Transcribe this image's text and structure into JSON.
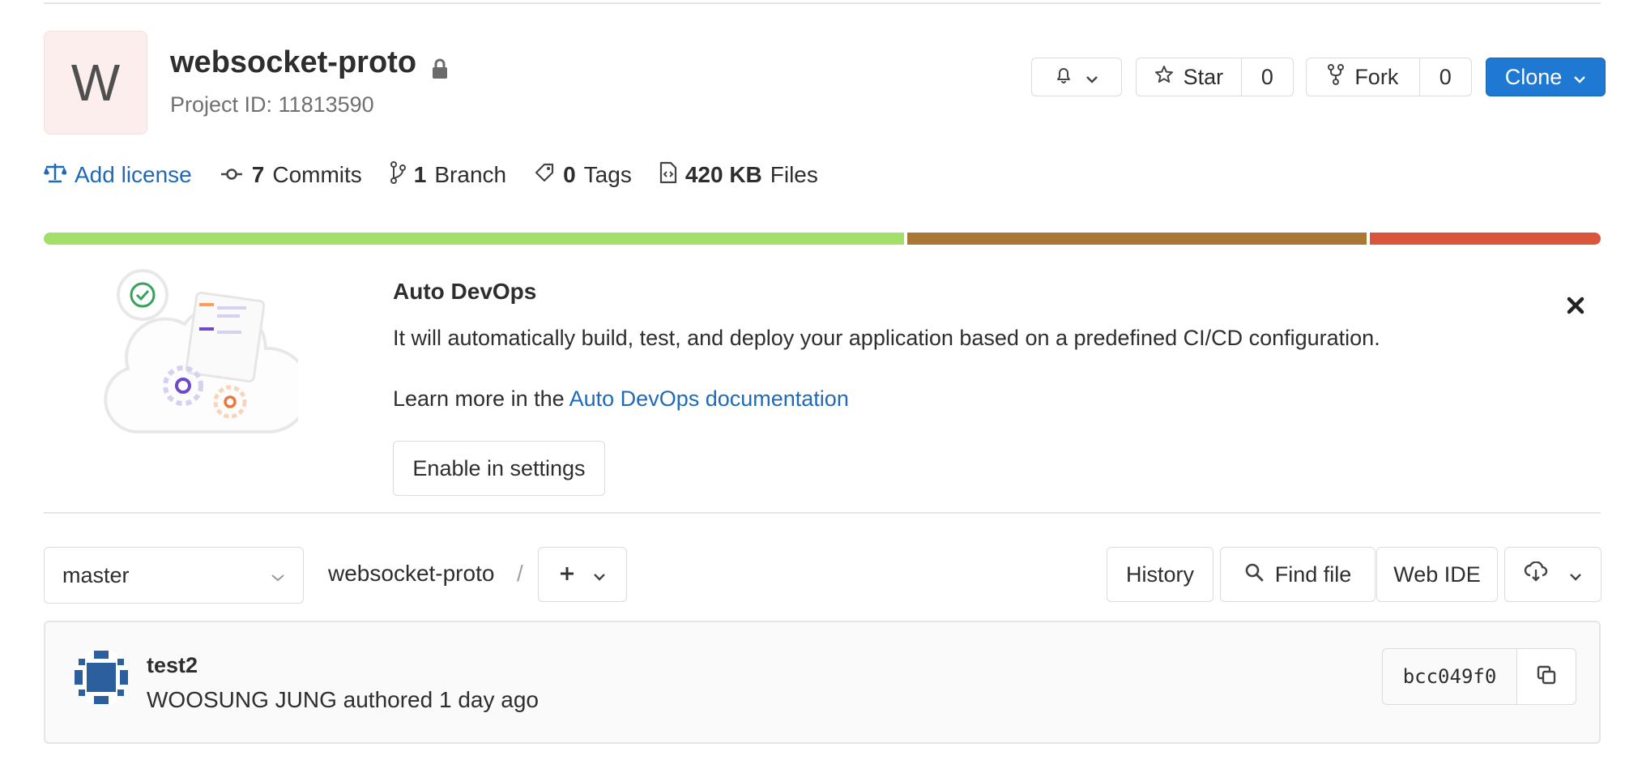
{
  "project": {
    "avatar_letter": "W",
    "name": "websocket-proto",
    "id_text": "Project ID: 11813590"
  },
  "header_actions": {
    "star_label": "Star",
    "star_count": "0",
    "fork_label": "Fork",
    "fork_count": "0",
    "clone_label": "Clone"
  },
  "stats": {
    "license_label": "Add license",
    "commits_count": "7",
    "commits_label": "Commits",
    "branches_count": "1",
    "branches_label": "Branch",
    "tags_count": "0",
    "tags_label": "Tags",
    "files_size": "420 KB",
    "files_label": "Files"
  },
  "languages": [
    {
      "color": "#a2e06a",
      "fraction": 0.555
    },
    {
      "color": "#a97834",
      "fraction": 0.296
    },
    {
      "color": "#d9553c",
      "fraction": 0.149
    }
  ],
  "auto_devops": {
    "title": "Auto DevOps",
    "description": "It will automatically build, test, and deploy your application based on a predefined CI/CD configuration.",
    "learn_prefix": "Learn more in the ",
    "learn_link": "Auto DevOps documentation",
    "enable_label": "Enable in settings"
  },
  "file_nav": {
    "branch": "master",
    "breadcrumb": "websocket-proto",
    "separator": "/",
    "history_label": "History",
    "find_file_label": "Find file",
    "web_ide_label": "Web IDE"
  },
  "last_commit": {
    "title": "test2",
    "meta": "WOOSUNG JUNG authored 1 day ago",
    "sha": "bcc049f0"
  },
  "colors": {
    "link": "#1f6ab8",
    "primary": "#1f78d1",
    "commit_avatar": "#2b5f9e"
  }
}
